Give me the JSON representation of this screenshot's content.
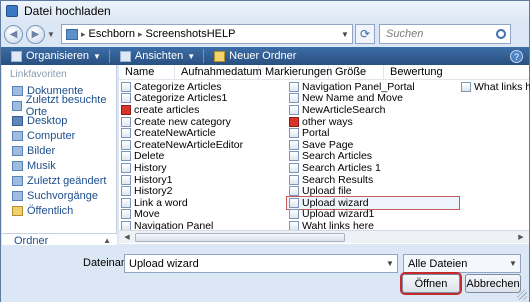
{
  "window": {
    "title": "Datei hochladen"
  },
  "address": {
    "segments": [
      "Eschborn",
      "ScreenshotsHELP"
    ]
  },
  "search": {
    "placeholder": "Suchen"
  },
  "toolbar": {
    "organize": "Organisieren",
    "views": "Ansichten",
    "new_folder": "Neuer Ordner"
  },
  "sidebar": {
    "heading": "Linkfavoriten",
    "items": [
      {
        "label": "Dokumente",
        "icon": "documents-icon"
      },
      {
        "label": "Zuletzt besuchte Orte",
        "icon": "recent-places-icon"
      },
      {
        "label": "Desktop",
        "icon": "desktop-icon"
      },
      {
        "label": "Computer",
        "icon": "computer-icon"
      },
      {
        "label": "Bilder",
        "icon": "pictures-icon"
      },
      {
        "label": "Musik",
        "icon": "music-icon"
      },
      {
        "label": "Zuletzt geändert",
        "icon": "recently-changed-icon"
      },
      {
        "label": "Suchvorgänge",
        "icon": "searches-icon"
      },
      {
        "label": "Öffentlich",
        "icon": "public-folder-icon"
      }
    ],
    "folders_label": "Ordner"
  },
  "columns": [
    "Name",
    "Aufnahmedatum",
    "Markierungen",
    "Größe",
    "Bewertung"
  ],
  "files": {
    "col1": [
      "Categorize Articles",
      "Categorize Articles1",
      "create articles",
      "Create new category",
      "CreateNewArticle",
      "CreateNewArticleEditor",
      "Delete",
      "History",
      "History1",
      "History2",
      "Link a word",
      "Move",
      "Navigation Panel"
    ],
    "col2": [
      "Navigation Panel_Portal",
      "New Name and Move",
      "NewArticleSearch",
      "other ways",
      "Portal",
      "Save Page",
      "Search Articles",
      "Search Articles 1",
      "Search Results",
      "Upload file",
      "Upload wizard",
      "Upload wizard1",
      "Waht links here"
    ],
    "col3": [
      "What links here"
    ],
    "pdf_items": [
      "create articles",
      "other ways"
    ],
    "selected": "Upload wizard"
  },
  "footer": {
    "filename_label": "Dateiname:",
    "filename_value": "Upload wizard",
    "filter_value": "Alle Dateien",
    "open_label": "Öffnen",
    "cancel_label": "Abbrechen"
  }
}
